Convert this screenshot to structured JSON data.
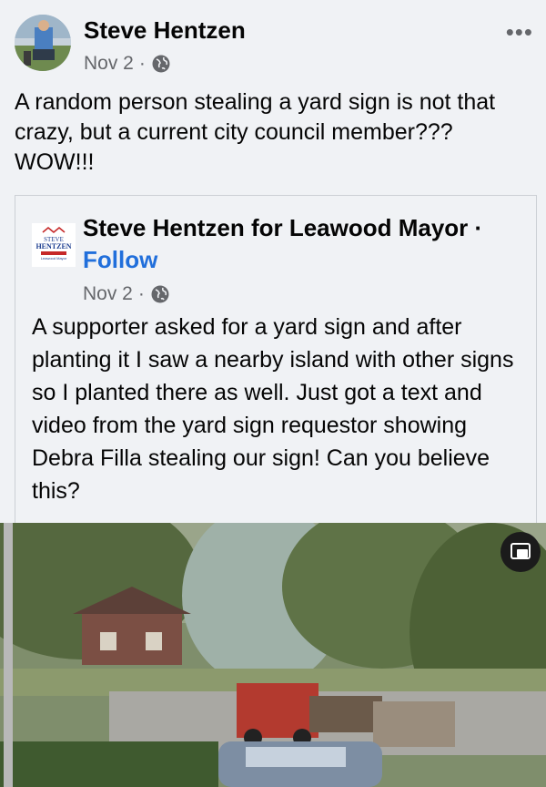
{
  "post": {
    "author": "Steve Hentzen",
    "date": "Nov 2",
    "separator": "·",
    "more_label": "•••",
    "text": "A random person stealing a yard sign is not that crazy, but a current city council member??? WOW!!!"
  },
  "shared_post": {
    "page_name": "Steve Hentzen for Leawood Mayor",
    "separator": "·",
    "follow_label": "Follow",
    "date": "Nov 2",
    "text": "A supporter asked for a yard sign and after planting it I saw a nearby island with other signs so I planted there as well.  Just got a text and video from the yard sign requestor showing Debra Filla stealing our sign!  Can you believe this?",
    "logo": {
      "line1": "STEVE",
      "line2": "HENTZEN",
      "line3": "Leawood Mayor"
    }
  },
  "icons": {
    "globe": "globe-icon",
    "more": "more-dots-icon",
    "pip": "picture-in-picture-icon"
  },
  "colors": {
    "accent": "#216fdb",
    "meta": "#65676b",
    "background": "#f0f2f5"
  }
}
